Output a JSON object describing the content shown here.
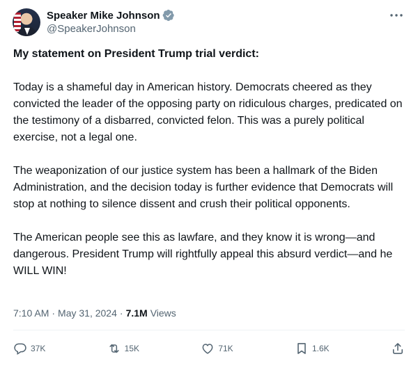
{
  "author": {
    "display_name": "Speaker Mike Johnson",
    "handle": "@SpeakerJohnson",
    "verified": true,
    "verified_color": "#829aab"
  },
  "tweet": {
    "title": "My statement on President Trump trial verdict:",
    "paragraphs": [
      "Today is a shameful day in American history. Democrats cheered as they convicted the leader of the opposing party on ridiculous charges, predicated on the testimony of a disbarred, convicted felon. This was a purely political exercise, not a legal one.",
      "The weaponization of our justice system has been a hallmark of the Biden Administration, and the decision today is further evidence that Democrats will stop at nothing to silence dissent and crush their political opponents.",
      "The American people see this as lawfare, and they know it is wrong—and dangerous. President Trump will rightfully appeal this absurd verdict—and he WILL WIN!"
    ]
  },
  "meta": {
    "time": "7:10 AM",
    "separator": "·",
    "date": "May 31, 2024",
    "views_count": "7.1M",
    "views_label": "Views"
  },
  "actions": {
    "replies": "37K",
    "reposts": "15K",
    "likes": "71K",
    "bookmarks": "1.6K"
  },
  "icons": {
    "more": "more-dots-icon",
    "verified": "verified-badge-icon",
    "reply": "reply-icon",
    "repost": "repost-icon",
    "like": "heart-icon",
    "bookmark": "bookmark-icon",
    "share": "share-icon"
  },
  "colors": {
    "text": "#0f1419",
    "secondary": "#536471",
    "divider": "#eff3f4"
  }
}
